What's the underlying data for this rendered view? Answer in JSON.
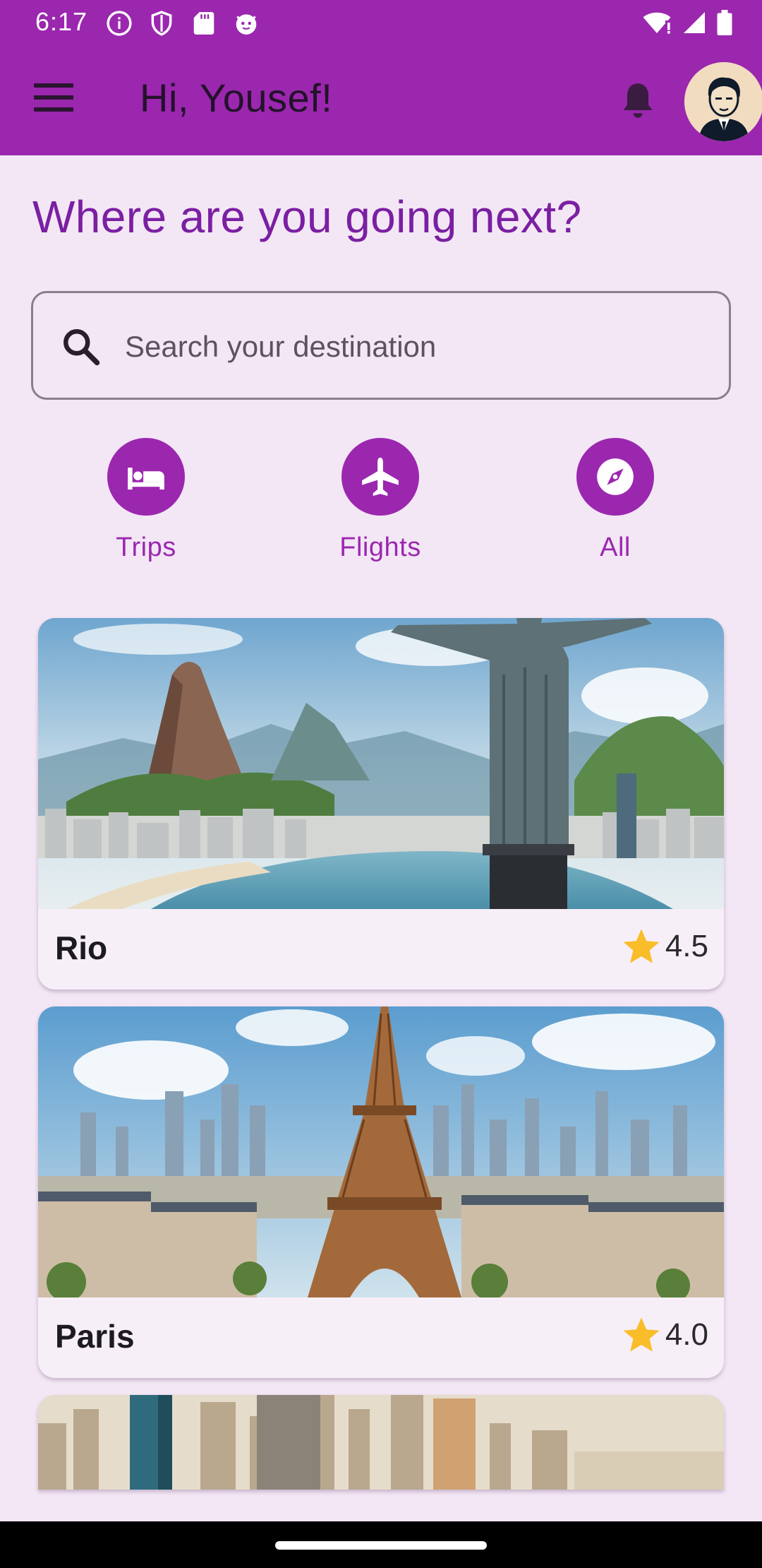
{
  "status_bar": {
    "time": "6:17"
  },
  "app_bar": {
    "greeting": "Hi, Yousef!",
    "background_color": "#9b27af"
  },
  "main": {
    "heading": "Where are you going next?",
    "search": {
      "placeholder": "Search your destination",
      "value": ""
    },
    "categories": [
      {
        "label": "Trips",
        "icon": "bed-icon"
      },
      {
        "label": "Flights",
        "icon": "airplane-icon"
      },
      {
        "label": "All",
        "icon": "compass-icon"
      }
    ],
    "destinations": [
      {
        "name": "Rio",
        "rating": "4.5"
      },
      {
        "name": "Paris",
        "rating": "4.0"
      },
      {
        "name": "",
        "rating": ""
      }
    ]
  },
  "colors": {
    "accent": "#9b27af",
    "heading": "#7b1fa2",
    "star": "#f9bd2a",
    "background": "#f3e7f5"
  }
}
